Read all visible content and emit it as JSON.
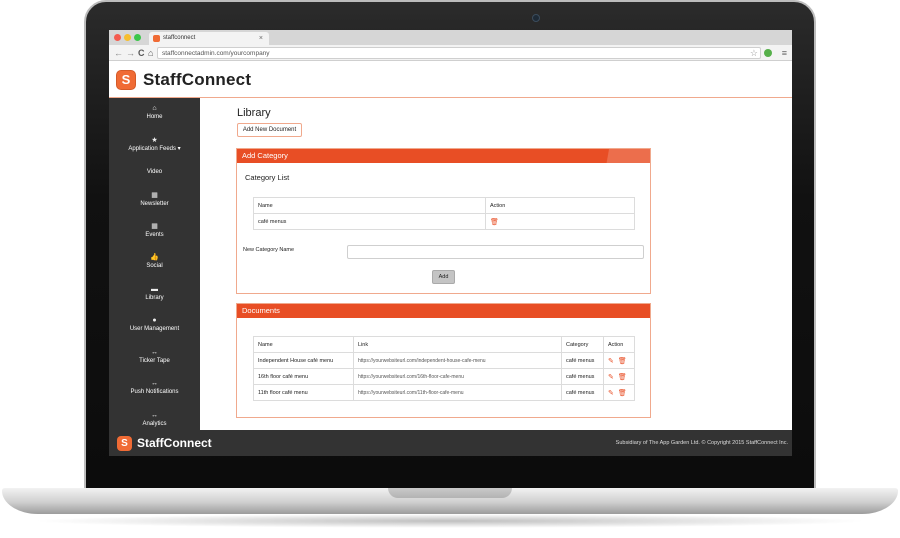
{
  "browser": {
    "tab_title": "staffconnect",
    "tab_close": "×",
    "url": "staffconnectadmin.com/yourcompany",
    "back": "←",
    "forward": "→",
    "reload": "C",
    "home": "⌂",
    "star": "☆",
    "menu": "≡"
  },
  "brand": {
    "logo_letter": "S",
    "name": "StaffConnect",
    "accent_color": "#e84e25"
  },
  "sidebar": {
    "items": [
      {
        "icon": "⌂",
        "label": "Home"
      },
      {
        "icon": "★",
        "label": "Application Feeds ▾"
      },
      {
        "icon": "",
        "label": "Video"
      },
      {
        "icon": "▦",
        "label": "Newsletter"
      },
      {
        "icon": "▦",
        "label": "Events"
      },
      {
        "icon": "👍",
        "label": "Social"
      },
      {
        "icon": "▬",
        "label": "Library"
      },
      {
        "icon": "●",
        "label": "User Management"
      },
      {
        "icon": "↔",
        "label": "Ticker Tape"
      },
      {
        "icon": "↔",
        "label": "Push Notifications"
      },
      {
        "icon": "↔",
        "label": "Analytics"
      }
    ]
  },
  "main": {
    "title": "Library",
    "add_document_label": "Add New Document",
    "category_panel": {
      "heading": "Add Category",
      "list_title": "Category List",
      "columns": [
        "Name",
        "Action"
      ],
      "rows": [
        {
          "name": "café menus"
        }
      ],
      "new_name_label": "New Category Name",
      "new_name_value": "",
      "add_label": "Add"
    },
    "documents_panel": {
      "heading": "Documents",
      "columns": [
        "Name",
        "Link",
        "Category",
        "Action"
      ],
      "rows": [
        {
          "name": "Independent House café menu",
          "link": "https://yourwebsiteurl.com/independent-house-cafe-menu",
          "category": "café menus"
        },
        {
          "name": "16th floor café menu",
          "link": "https://yourwebsiteurl.com/16th-floor-cafe-menu",
          "category": "café menus"
        },
        {
          "name": "11th floor café menu",
          "link": "https://yourwebsiteurl.com/11th-floor-cafe-menu",
          "category": "café menus"
        }
      ]
    }
  },
  "footer": {
    "logo_letter": "S",
    "name": "StaffConnect",
    "copyright": "Subsidiary of The App Garden Ltd. © Copyright 2015 StaffConnect Inc."
  },
  "icons": {
    "trash": "🗑",
    "pencil": "✎"
  }
}
